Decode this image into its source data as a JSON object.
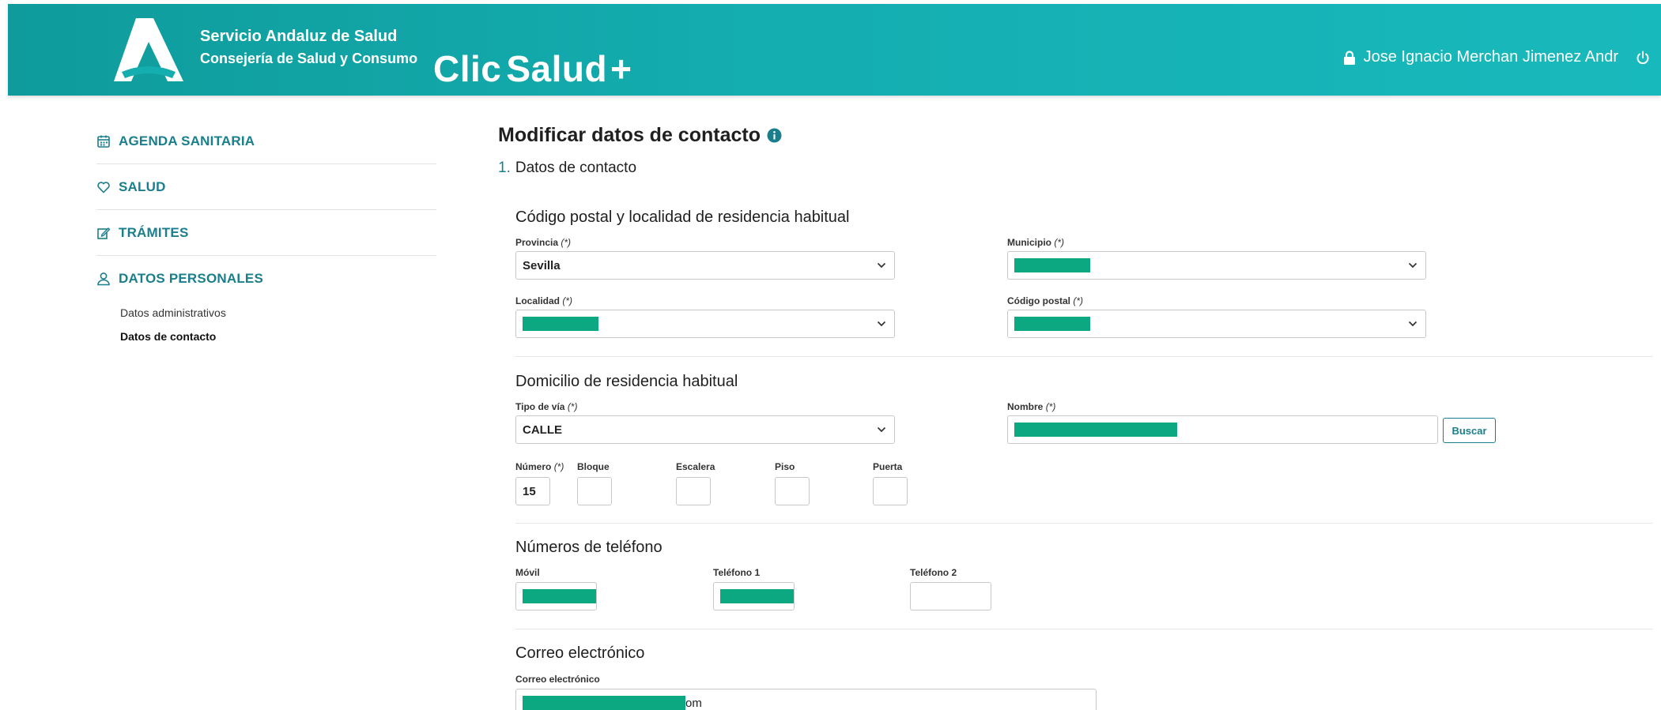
{
  "header": {
    "org_line1": "Servicio Andaluz de Salud",
    "org_line2": "Consejería de Salud y Consumo",
    "brand_part1": "Clic",
    "brand_part2": "Salud",
    "brand_plus": "+",
    "user_name": "Jose Ignacio Merchan Jimenez Andr",
    "icons": [
      "lock-icon",
      "power-icon"
    ]
  },
  "sidebar": {
    "items": [
      {
        "label": "AGENDA SANITARIA",
        "icon": "calendar-icon"
      },
      {
        "label": "SALUD",
        "icon": "heart-icon"
      },
      {
        "label": "TRÁMITES",
        "icon": "edit-icon"
      },
      {
        "label": "DATOS PERSONALES",
        "icon": "user-icon"
      }
    ],
    "subitems": [
      {
        "label": "Datos administrativos",
        "active": false
      },
      {
        "label": "Datos de contacto",
        "active": true
      }
    ]
  },
  "main": {
    "title": "Modificar datos de contacto",
    "step_number": "1.",
    "step_label": "Datos de contacto",
    "sections": {
      "residence": {
        "title": "Código postal y localidad de residencia habitual",
        "provincia_label": "Provincia",
        "provincia_value": "Sevilla",
        "municipio_label": "Municipio",
        "localidad_label": "Localidad",
        "cp_label": "Código postal"
      },
      "address": {
        "title": "Domicilio de residencia habitual",
        "tipo_via_label": "Tipo de vía",
        "tipo_via_value": "CALLE",
        "nombre_label": "Nombre",
        "buscar_button": "Buscar",
        "numero_label": "Número",
        "numero_value": "15",
        "bloque_label": "Bloque",
        "escalera_label": "Escalera",
        "piso_label": "Piso",
        "puerta_label": "Puerta"
      },
      "phones": {
        "title": "Números de teléfono",
        "movil_label": "Móvil",
        "tel1_label": "Teléfono 1",
        "tel2_label": "Teléfono 2"
      },
      "email": {
        "title": "Correo electrónico",
        "email_label": "Correo electrónico",
        "email_visible_suffix": "om"
      }
    },
    "required_mark": "(*)"
  },
  "colors": {
    "header_start": "#0f9b9b",
    "header_end": "#18b9bc",
    "accent": "#1a7f8c",
    "redaction": "#0ba882"
  }
}
